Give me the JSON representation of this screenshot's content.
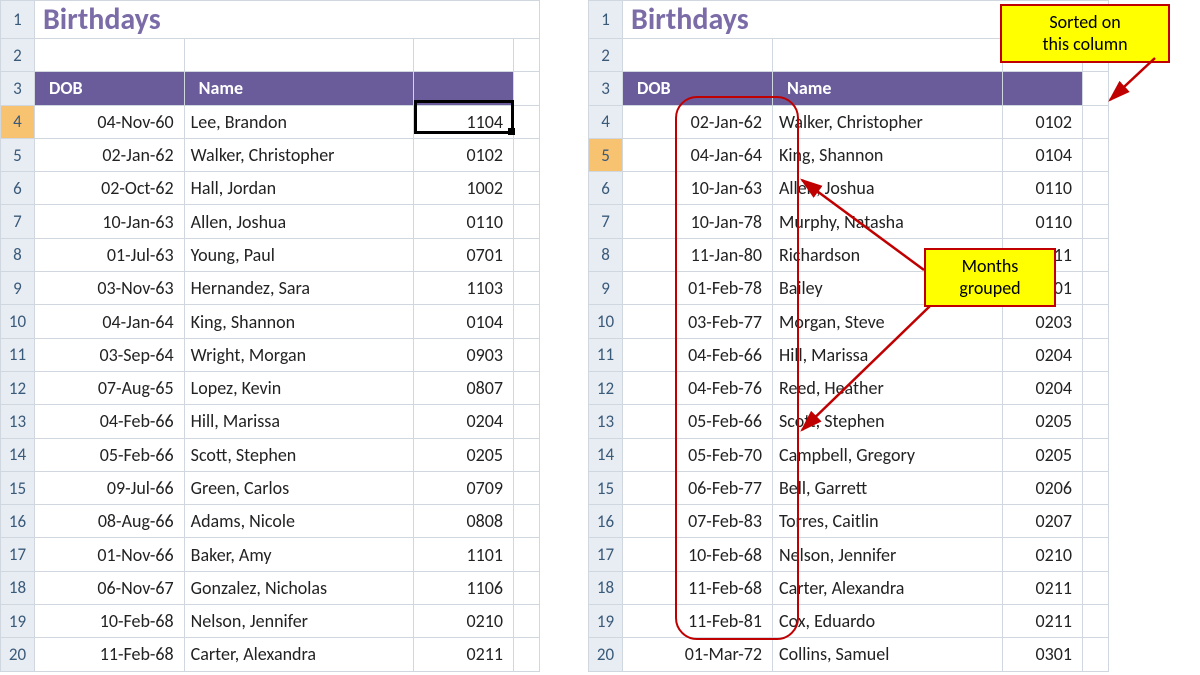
{
  "title": "Birthdays",
  "headers": {
    "dob": "DOB",
    "name": "Name"
  },
  "callouts": {
    "sorted": "Sorted on\nthis column",
    "months": "Months\ngrouped"
  },
  "left": {
    "start_row": 1,
    "selected_row": 4,
    "rows": [
      {
        "dob": "04-Nov-60",
        "name": "Lee, Brandon",
        "code": "1104"
      },
      {
        "dob": "02-Jan-62",
        "name": "Walker, Christopher",
        "code": "0102"
      },
      {
        "dob": "02-Oct-62",
        "name": "Hall, Jordan",
        "code": "1002"
      },
      {
        "dob": "10-Jan-63",
        "name": "Allen, Joshua",
        "code": "0110"
      },
      {
        "dob": "01-Jul-63",
        "name": "Young, Paul",
        "code": "0701"
      },
      {
        "dob": "03-Nov-63",
        "name": "Hernandez, Sara",
        "code": "1103"
      },
      {
        "dob": "04-Jan-64",
        "name": "King, Shannon",
        "code": "0104"
      },
      {
        "dob": "03-Sep-64",
        "name": "Wright, Morgan",
        "code": "0903"
      },
      {
        "dob": "07-Aug-65",
        "name": "Lopez, Kevin",
        "code": "0807"
      },
      {
        "dob": "04-Feb-66",
        "name": "Hill, Marissa",
        "code": "0204"
      },
      {
        "dob": "05-Feb-66",
        "name": "Scott, Stephen",
        "code": "0205"
      },
      {
        "dob": "09-Jul-66",
        "name": "Green, Carlos",
        "code": "0709"
      },
      {
        "dob": "08-Aug-66",
        "name": "Adams, Nicole",
        "code": "0808"
      },
      {
        "dob": "01-Nov-66",
        "name": "Baker, Amy",
        "code": "1101"
      },
      {
        "dob": "06-Nov-67",
        "name": "Gonzalez, Nicholas",
        "code": "1106"
      },
      {
        "dob": "10-Feb-68",
        "name": "Nelson, Jennifer",
        "code": "0210"
      },
      {
        "dob": "11-Feb-68",
        "name": "Carter, Alexandra",
        "code": "0211"
      }
    ]
  },
  "right": {
    "start_row": 1,
    "selected_row": 5,
    "rows": [
      {
        "dob": "02-Jan-62",
        "name": "Walker, Christopher",
        "code": "0102"
      },
      {
        "dob": "04-Jan-64",
        "name": "King, Shannon",
        "code": "0104"
      },
      {
        "dob": "10-Jan-63",
        "name": "Allen, Joshua",
        "code": "0110"
      },
      {
        "dob": "10-Jan-78",
        "name": "Murphy, Natasha",
        "code": "0110"
      },
      {
        "dob": "11-Jan-80",
        "name": "Richardson",
        "code": "0111"
      },
      {
        "dob": "01-Feb-78",
        "name": "Bailey",
        "code": "0201"
      },
      {
        "dob": "03-Feb-77",
        "name": "Morgan, Steve",
        "code": "0203"
      },
      {
        "dob": "04-Feb-66",
        "name": "Hill, Marissa",
        "code": "0204"
      },
      {
        "dob": "04-Feb-76",
        "name": "Reed, Heather",
        "code": "0204"
      },
      {
        "dob": "05-Feb-66",
        "name": "Scott, Stephen",
        "code": "0205"
      },
      {
        "dob": "05-Feb-70",
        "name": "Campbell, Gregory",
        "code": "0205"
      },
      {
        "dob": "06-Feb-77",
        "name": "Bell, Garrett",
        "code": "0206"
      },
      {
        "dob": "07-Feb-83",
        "name": "Torres, Caitlin",
        "code": "0207"
      },
      {
        "dob": "10-Feb-68",
        "name": "Nelson, Jennifer",
        "code": "0210"
      },
      {
        "dob": "11-Feb-68",
        "name": "Carter, Alexandra",
        "code": "0211"
      },
      {
        "dob": "11-Feb-81",
        "name": "Cox, Eduardo",
        "code": "0211"
      },
      {
        "dob": "01-Mar-72",
        "name": "Collins, Samuel",
        "code": "0301"
      }
    ]
  }
}
